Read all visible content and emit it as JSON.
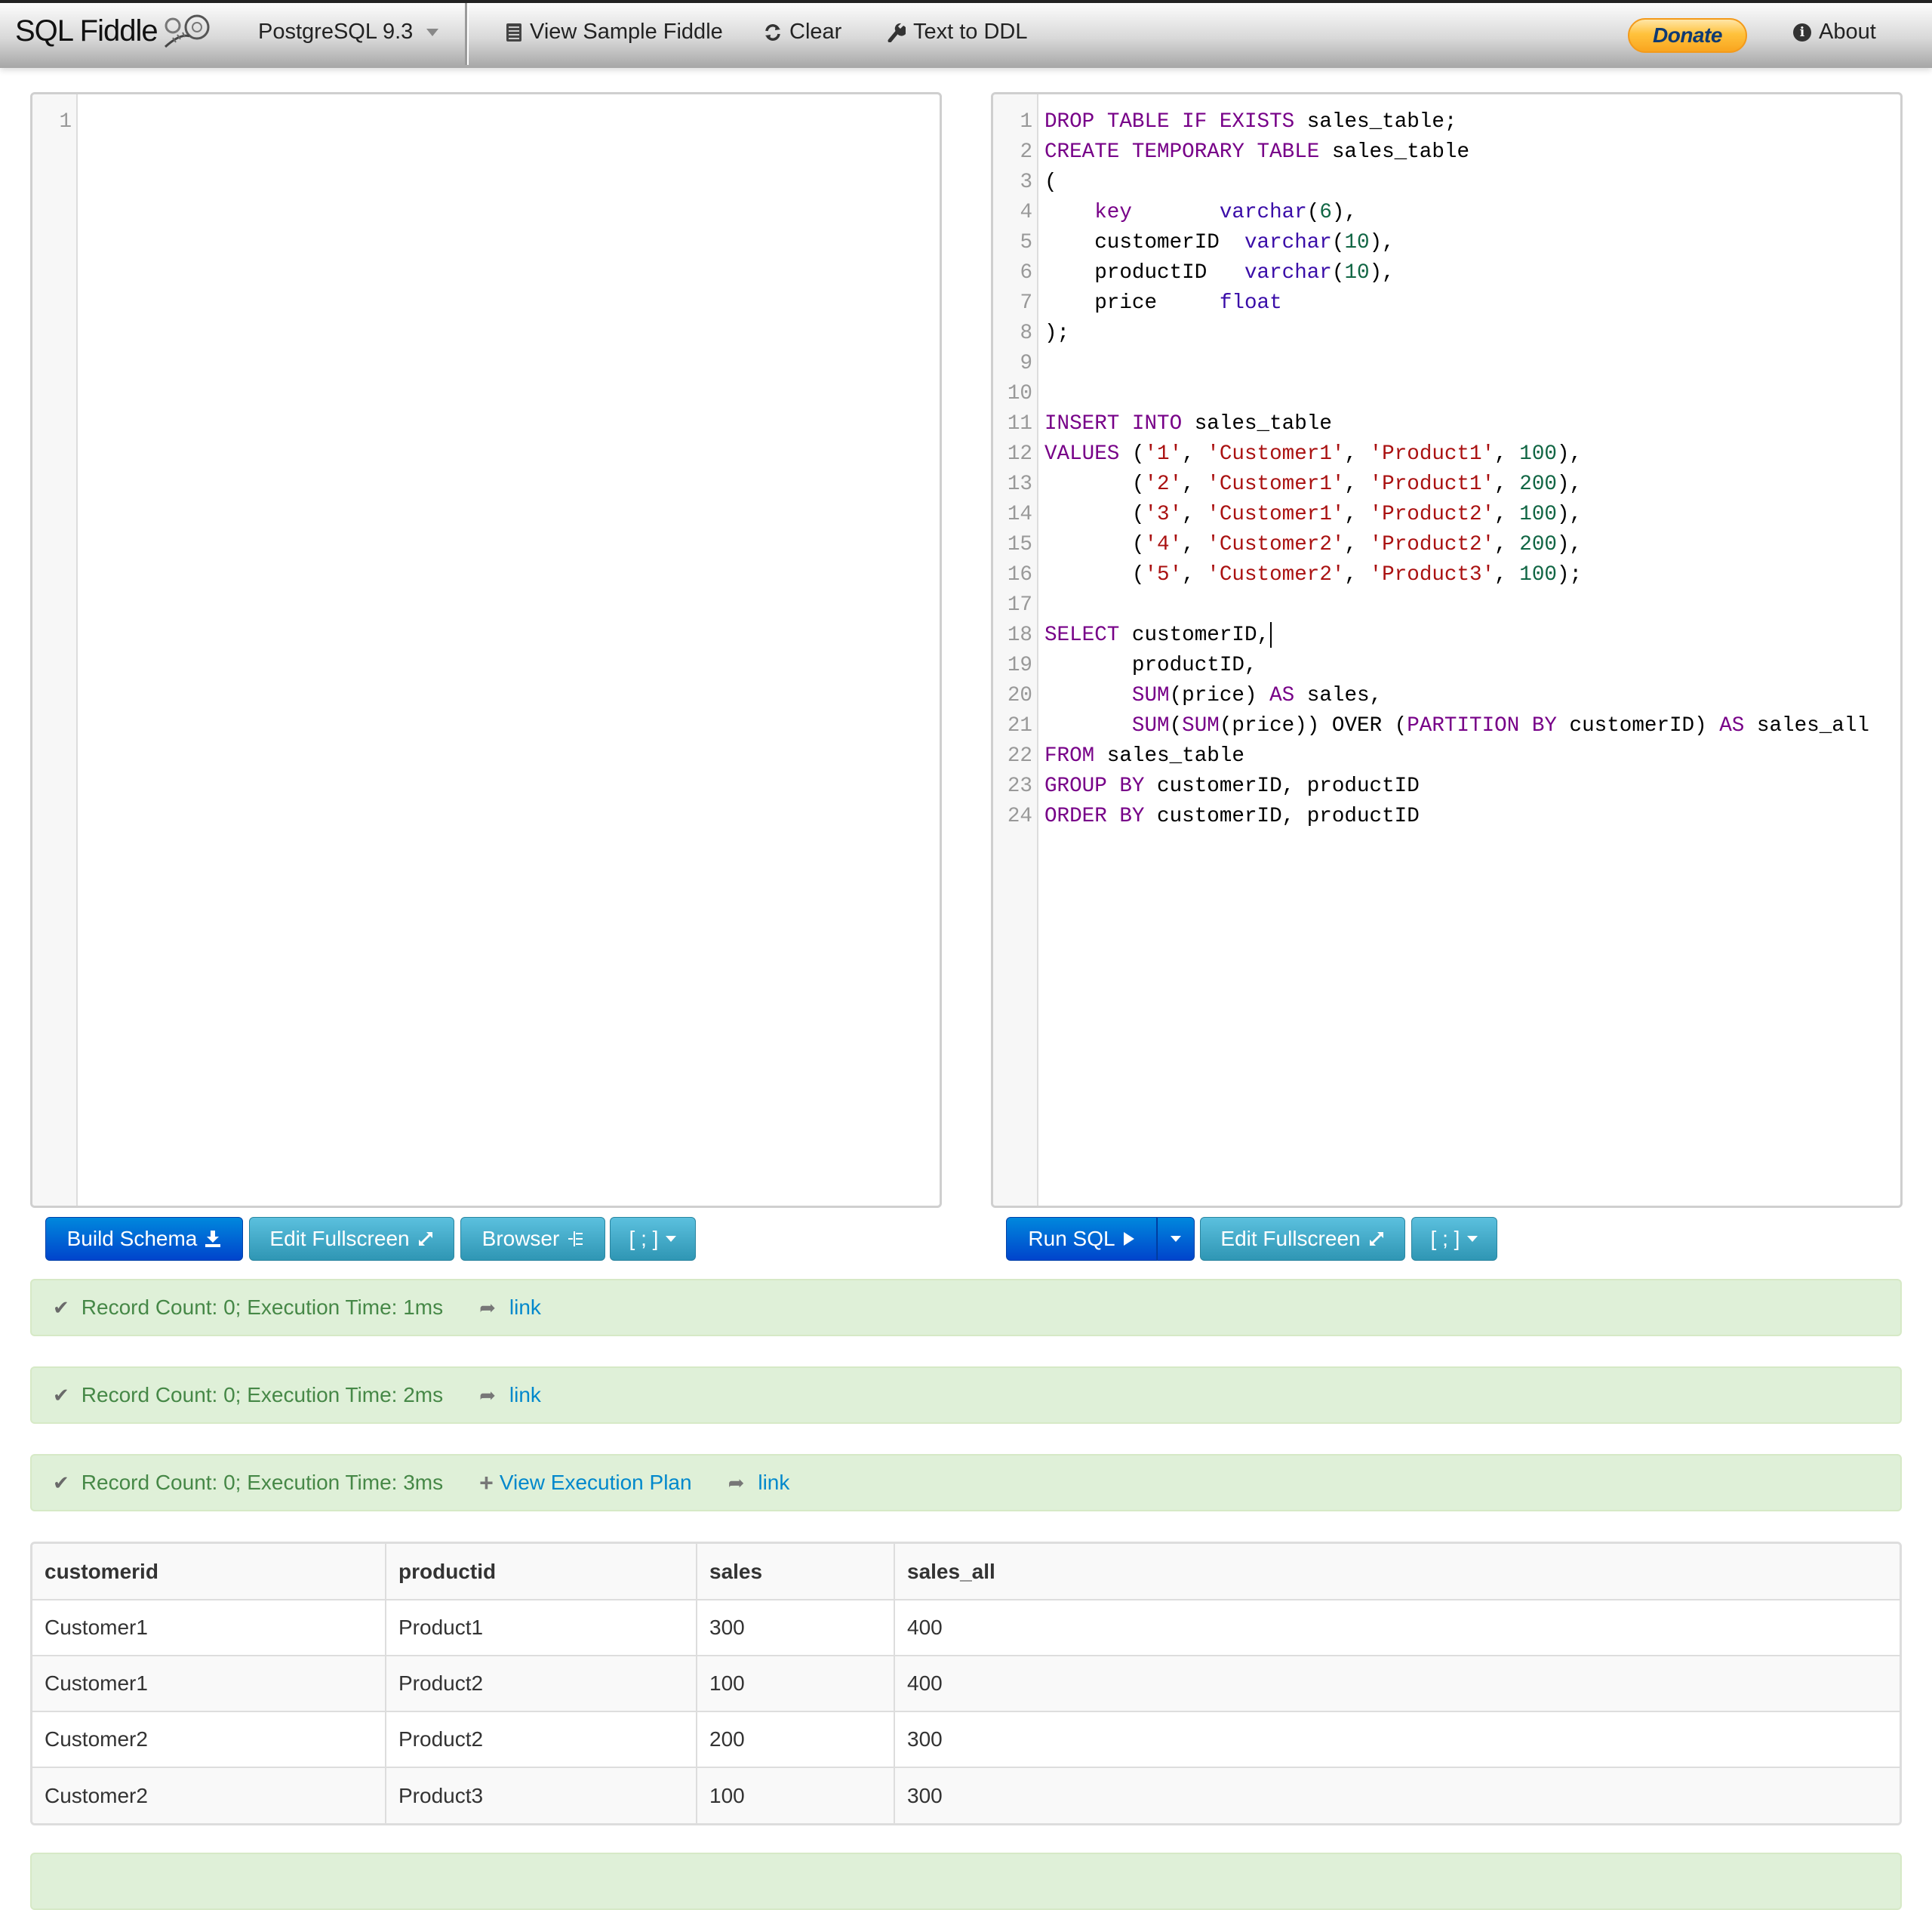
{
  "navbar": {
    "brand": "SQL Fiddle",
    "database": "PostgreSQL 9.3",
    "view_sample": "View Sample Fiddle",
    "clear": "Clear",
    "text_to_ddl": "Text to DDL",
    "donate": "Donate",
    "about": "About"
  },
  "schema_editor": {
    "lines": [
      {
        "n": "1",
        "tokens": []
      }
    ]
  },
  "query_editor": {
    "lines": [
      {
        "n": "1",
        "tokens": [
          [
            "kw",
            "DROP"
          ],
          [
            "t",
            " "
          ],
          [
            "kw",
            "TABLE"
          ],
          [
            "t",
            " "
          ],
          [
            "kw",
            "IF"
          ],
          [
            "t",
            " "
          ],
          [
            "kw",
            "EXISTS"
          ],
          [
            "t",
            " sales_table;"
          ]
        ]
      },
      {
        "n": "2",
        "tokens": [
          [
            "kw",
            "CREATE"
          ],
          [
            "t",
            " "
          ],
          [
            "kw",
            "TEMPORARY"
          ],
          [
            "t",
            " "
          ],
          [
            "kw",
            "TABLE"
          ],
          [
            "t",
            " sales_table"
          ]
        ]
      },
      {
        "n": "3",
        "tokens": [
          [
            "t",
            "("
          ]
        ]
      },
      {
        "n": "4",
        "tokens": [
          [
            "t",
            "    "
          ],
          [
            "kw",
            "key"
          ],
          [
            "t",
            "       "
          ],
          [
            "ty",
            "varchar"
          ],
          [
            "t",
            "("
          ],
          [
            "nu",
            "6"
          ],
          [
            "t",
            "),"
          ]
        ]
      },
      {
        "n": "5",
        "tokens": [
          [
            "t",
            "    customerID  "
          ],
          [
            "ty",
            "varchar"
          ],
          [
            "t",
            "("
          ],
          [
            "nu",
            "10"
          ],
          [
            "t",
            "),"
          ]
        ]
      },
      {
        "n": "6",
        "tokens": [
          [
            "t",
            "    productID   "
          ],
          [
            "ty",
            "varchar"
          ],
          [
            "t",
            "("
          ],
          [
            "nu",
            "10"
          ],
          [
            "t",
            "),"
          ]
        ]
      },
      {
        "n": "7",
        "tokens": [
          [
            "t",
            "    price     "
          ],
          [
            "ty",
            "float"
          ]
        ]
      },
      {
        "n": "8",
        "tokens": [
          [
            "t",
            ");"
          ]
        ]
      },
      {
        "n": "9",
        "tokens": []
      },
      {
        "n": "10",
        "tokens": []
      },
      {
        "n": "11",
        "tokens": [
          [
            "kw",
            "INSERT"
          ],
          [
            "t",
            " "
          ],
          [
            "kw",
            "INTO"
          ],
          [
            "t",
            " sales_table"
          ]
        ]
      },
      {
        "n": "12",
        "tokens": [
          [
            "kw",
            "VALUES"
          ],
          [
            "t",
            " ("
          ],
          [
            "st",
            "'1'"
          ],
          [
            "t",
            ", "
          ],
          [
            "st",
            "'Customer1'"
          ],
          [
            "t",
            ", "
          ],
          [
            "st",
            "'Product1'"
          ],
          [
            "t",
            ", "
          ],
          [
            "nu",
            "100"
          ],
          [
            "t",
            "),"
          ]
        ]
      },
      {
        "n": "13",
        "tokens": [
          [
            "t",
            "       ("
          ],
          [
            "st",
            "'2'"
          ],
          [
            "t",
            ", "
          ],
          [
            "st",
            "'Customer1'"
          ],
          [
            "t",
            ", "
          ],
          [
            "st",
            "'Product1'"
          ],
          [
            "t",
            ", "
          ],
          [
            "nu",
            "200"
          ],
          [
            "t",
            "),"
          ]
        ]
      },
      {
        "n": "14",
        "tokens": [
          [
            "t",
            "       ("
          ],
          [
            "st",
            "'3'"
          ],
          [
            "t",
            ", "
          ],
          [
            "st",
            "'Customer1'"
          ],
          [
            "t",
            ", "
          ],
          [
            "st",
            "'Product2'"
          ],
          [
            "t",
            ", "
          ],
          [
            "nu",
            "100"
          ],
          [
            "t",
            "),"
          ]
        ]
      },
      {
        "n": "15",
        "tokens": [
          [
            "t",
            "       ("
          ],
          [
            "st",
            "'4'"
          ],
          [
            "t",
            ", "
          ],
          [
            "st",
            "'Customer2'"
          ],
          [
            "t",
            ", "
          ],
          [
            "st",
            "'Product2'"
          ],
          [
            "t",
            ", "
          ],
          [
            "nu",
            "200"
          ],
          [
            "t",
            "),"
          ]
        ]
      },
      {
        "n": "16",
        "tokens": [
          [
            "t",
            "       ("
          ],
          [
            "st",
            "'5'"
          ],
          [
            "t",
            ", "
          ],
          [
            "st",
            "'Customer2'"
          ],
          [
            "t",
            ", "
          ],
          [
            "st",
            "'Product3'"
          ],
          [
            "t",
            ", "
          ],
          [
            "nu",
            "100"
          ],
          [
            "t",
            ");"
          ]
        ]
      },
      {
        "n": "17",
        "tokens": []
      },
      {
        "n": "18",
        "tokens": [
          [
            "kw",
            "SELECT"
          ],
          [
            "t",
            " customerID,"
          ],
          [
            "cursor",
            ""
          ]
        ]
      },
      {
        "n": "19",
        "tokens": [
          [
            "t",
            "       productID,"
          ]
        ]
      },
      {
        "n": "20",
        "tokens": [
          [
            "t",
            "       "
          ],
          [
            "kw",
            "SUM"
          ],
          [
            "t",
            "(price) "
          ],
          [
            "kw",
            "AS"
          ],
          [
            "t",
            " sales,"
          ]
        ]
      },
      {
        "n": "21",
        "tokens": [
          [
            "t",
            "       "
          ],
          [
            "kw",
            "SUM"
          ],
          [
            "t",
            "("
          ],
          [
            "kw",
            "SUM"
          ],
          [
            "t",
            "(price)) OVER ("
          ],
          [
            "kw",
            "PARTITION"
          ],
          [
            "t",
            " "
          ],
          [
            "kw",
            "BY"
          ],
          [
            "t",
            " customerID) "
          ],
          [
            "kw",
            "AS"
          ],
          [
            "t",
            " sales_all"
          ]
        ]
      },
      {
        "n": "22",
        "tokens": [
          [
            "kw",
            "FROM"
          ],
          [
            "t",
            " sales_table"
          ]
        ]
      },
      {
        "n": "23",
        "tokens": [
          [
            "kw",
            "GROUP"
          ],
          [
            "t",
            " "
          ],
          [
            "kw",
            "BY"
          ],
          [
            "t",
            " customerID, productID"
          ]
        ]
      },
      {
        "n": "24",
        "tokens": [
          [
            "kw",
            "ORDER"
          ],
          [
            "t",
            " "
          ],
          [
            "kw",
            "BY"
          ],
          [
            "t",
            " customerID, productID"
          ]
        ]
      }
    ]
  },
  "schema_buttons": {
    "build_schema": "Build Schema",
    "edit_fullscreen": "Edit Fullscreen",
    "browser": "Browser",
    "terminator": "[ ; ]"
  },
  "query_buttons": {
    "run_sql": "Run SQL",
    "edit_fullscreen": "Edit Fullscreen",
    "terminator": "[ ; ]"
  },
  "results_status": [
    {
      "text": "Record Count: 0; Execution Time: 1ms",
      "link": "link"
    },
    {
      "text": "Record Count: 0; Execution Time: 2ms",
      "link": "link"
    },
    {
      "text": "Record Count: 0; Execution Time: 3ms",
      "plan": "View Execution Plan",
      "link": "link"
    }
  ],
  "results_table": {
    "columns": [
      "customerid",
      "productid",
      "sales",
      "sales_all"
    ],
    "rows": [
      [
        "Customer1",
        "Product1",
        "300",
        "400"
      ],
      [
        "Customer1",
        "Product2",
        "100",
        "400"
      ],
      [
        "Customer2",
        "Product2",
        "200",
        "300"
      ],
      [
        "Customer2",
        "Product3",
        "100",
        "300"
      ]
    ]
  },
  "colors": {
    "keyword": "#770088",
    "type": "#3a0da8",
    "string": "#aa1111",
    "number": "#116644",
    "primary_button": "#0055cc",
    "info_button": "#49afcd",
    "success_bg": "#dff0d8",
    "success_text": "#468847",
    "link": "#0088cc"
  }
}
